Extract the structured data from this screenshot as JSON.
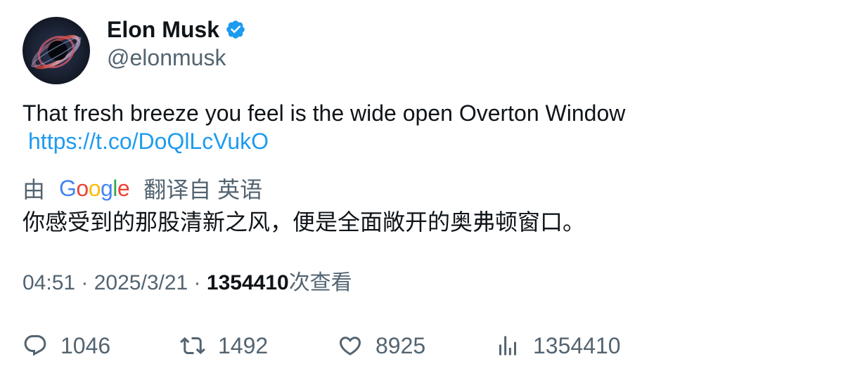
{
  "author": {
    "display_name": "Elon Musk",
    "handle": "@elonmusk",
    "avatar_icon": "black-hole-avatar",
    "verified_icon": "verified-badge-icon",
    "verified_color": "#1d9bf0"
  },
  "tweet": {
    "text": "That fresh breeze you feel is the wide open Overton Window",
    "link": "https://t.co/DoQlLcVukO",
    "link_color": "#1d9bf0"
  },
  "translation": {
    "prefix": "由",
    "provider": "Google",
    "suffix": "翻译自 英语",
    "text": "你感受到的那股清新之风，便是全面敞开的奥弗顿窗口。"
  },
  "meta": {
    "time": "04:51",
    "separator": " · ",
    "date": "2025/3/21",
    "views_count": "1354410",
    "views_label": "次查看"
  },
  "actions": {
    "replies": {
      "icon": "reply-icon",
      "count": "1046"
    },
    "retweets": {
      "icon": "retweet-icon",
      "count": "1492"
    },
    "likes": {
      "icon": "heart-icon",
      "count": "8925"
    },
    "views": {
      "icon": "analytics-icon",
      "count": "1354410"
    }
  },
  "colors": {
    "text_primary": "#0f1419",
    "text_secondary": "#536471",
    "google_blue": "#4285f4",
    "google_red": "#ea4335",
    "google_yellow": "#fbbc05",
    "google_green": "#34a853"
  }
}
